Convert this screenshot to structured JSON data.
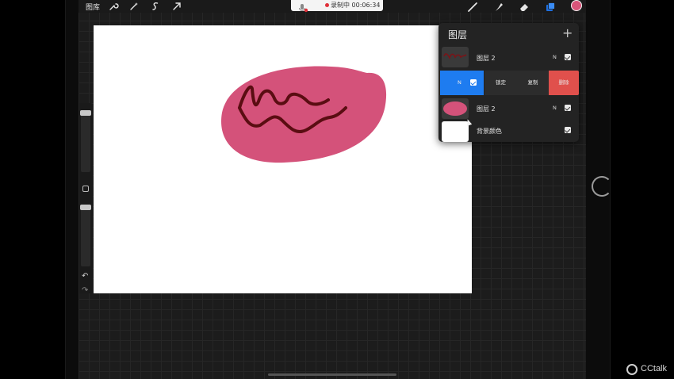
{
  "toolbar": {
    "gallery_label": "图库",
    "left_tools": [
      "wrench-icon",
      "magic-wand-icon",
      "selection-icon",
      "transform-arrow-icon"
    ],
    "right_tools": [
      "brush-icon",
      "smudge-icon",
      "eraser-icon",
      "layers-icon"
    ],
    "current_color": "#d9557a"
  },
  "recording": {
    "label": "录制中 00:06:34",
    "mic_icon": "muted-mic-icon"
  },
  "layers_panel": {
    "title": "图层",
    "add_icon": "+",
    "layers": [
      {
        "name": "图层 2",
        "blend": "N",
        "visible": true,
        "thumb": "squiggle"
      },
      {
        "name": "图层 2",
        "blend": "N",
        "visible": true,
        "thumb": "pink-ellipse"
      },
      {
        "name": "背景颜色",
        "visible": true,
        "thumb": "white"
      }
    ],
    "actions": {
      "blend_label": "N",
      "lock_label": "锁定",
      "duplicate_label": "复制",
      "delete_label": "删除"
    }
  },
  "canvas": {
    "blob_color": "#d4527a",
    "stroke_color": "#5a0d12",
    "background": "#ffffff"
  },
  "watermark": {
    "brand": "CCtalk"
  }
}
